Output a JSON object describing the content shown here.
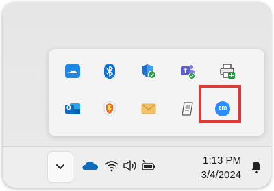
{
  "tray_overflow": {
    "row1": [
      {
        "name": "zoom-cloud-icon",
        "label": ""
      },
      {
        "name": "bluetooth-icon",
        "label": ""
      },
      {
        "name": "windows-security-icon",
        "label": ""
      },
      {
        "name": "teams-icon",
        "label": ""
      },
      {
        "name": "printer-icon",
        "label": ""
      }
    ],
    "row2": [
      {
        "name": "outlook-icon",
        "label": "o"
      },
      {
        "name": "shield-app-icon",
        "label": ""
      },
      {
        "name": "mail-icon",
        "label": ""
      },
      {
        "name": "document-icon",
        "label": ""
      },
      {
        "name": "zoom-icon",
        "label": "zm"
      }
    ],
    "highlighted": "zoom-icon",
    "highlight_color": "#e03a36"
  },
  "taskbar": {
    "time": "1:13 PM",
    "date": "3/4/2024",
    "icons": [
      "chevron-up-icon",
      "onedrive-icon",
      "wifi-icon",
      "volume-icon",
      "battery-icon",
      "notification-bell-icon"
    ]
  },
  "colors": {
    "zoom_blue": "#2d8cff",
    "bluetooth_blue": "#0a74da",
    "teams_purple": "#5b5fc7",
    "outlook_blue": "#0f6cbd",
    "onedrive_blue": "#0f6cbd"
  }
}
